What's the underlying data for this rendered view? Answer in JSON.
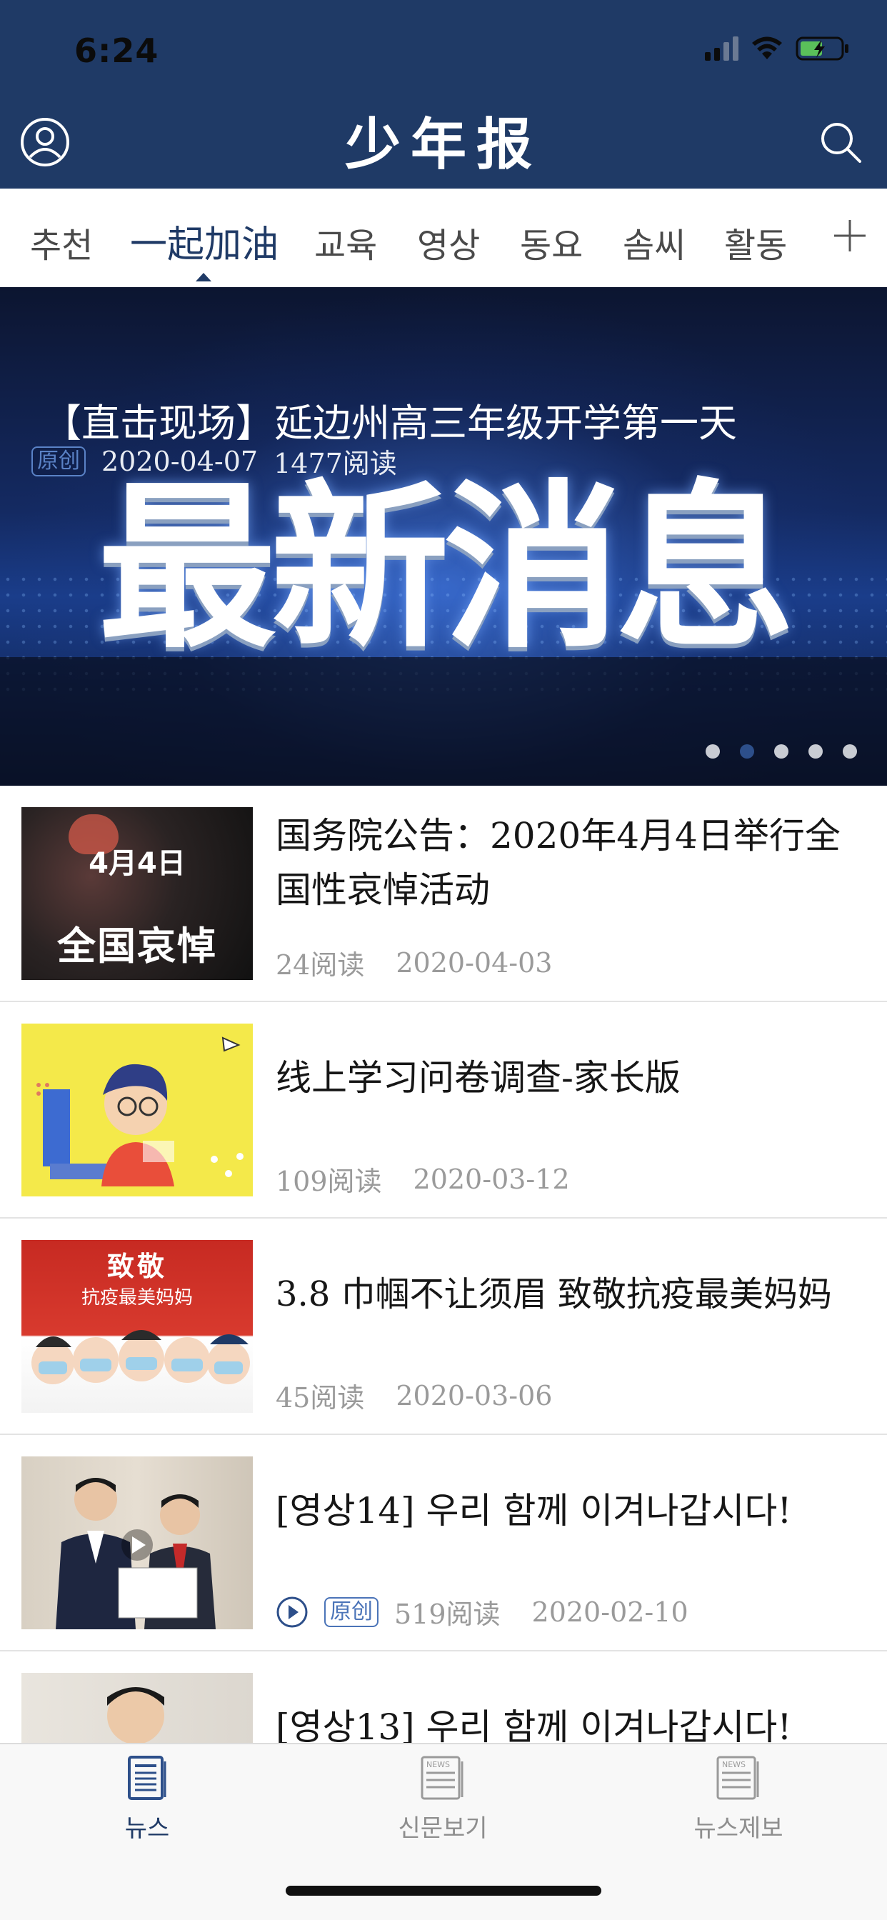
{
  "status_bar": {
    "time": "6:24"
  },
  "header": {
    "title": "少年报"
  },
  "tabs": [
    {
      "label": "추천",
      "active": false
    },
    {
      "label": "一起加油",
      "active": true
    },
    {
      "label": "교육",
      "active": false
    },
    {
      "label": "영상",
      "active": false
    },
    {
      "label": "동요",
      "active": false
    },
    {
      "label": "솜씨",
      "active": false
    },
    {
      "label": "활동",
      "active": false
    }
  ],
  "banner": {
    "image_text": "最新消息",
    "title": "【直击现场】延边州高三年级开学第一天",
    "badge": "原创",
    "date": "2020-04-07",
    "reads": "1477阅读",
    "page_count": 5,
    "active_page": 2
  },
  "news": [
    {
      "title": "国务院公告：2020年4月4日举行全国性哀悼活动",
      "reads": "24阅读",
      "date": "2020-04-03",
      "thumb_text_1": "4月4日",
      "thumb_text_2": "全国哀悼"
    },
    {
      "title": "线上学习问卷调查-家长版",
      "reads": "109阅读",
      "date": "2020-03-12"
    },
    {
      "title": "3.8 巾帼不让须眉 致敬抗疫最美妈妈",
      "reads": "45阅读",
      "date": "2020-03-06",
      "thumb_text_1": "致敬",
      "thumb_text_2": "抗疫最美妈妈"
    },
    {
      "title": "[영상14] 우리 함께 이겨나갑시다!",
      "badge": "原创",
      "reads": "519阅读",
      "date": "2020-02-10",
      "has_video": true
    },
    {
      "title": "[영상13] 우리 함께 이겨나갑시다!"
    }
  ],
  "bottom_nav": [
    {
      "label": "뉴스",
      "icon": "newspaper-icon",
      "active": true
    },
    {
      "label": "신문보기",
      "icon": "news-paper-view-icon",
      "active": false
    },
    {
      "label": "뉴스제보",
      "icon": "news-report-icon",
      "active": false
    }
  ],
  "colors": {
    "primary": "#1f3a66",
    "text_muted": "#9a9a9a"
  }
}
